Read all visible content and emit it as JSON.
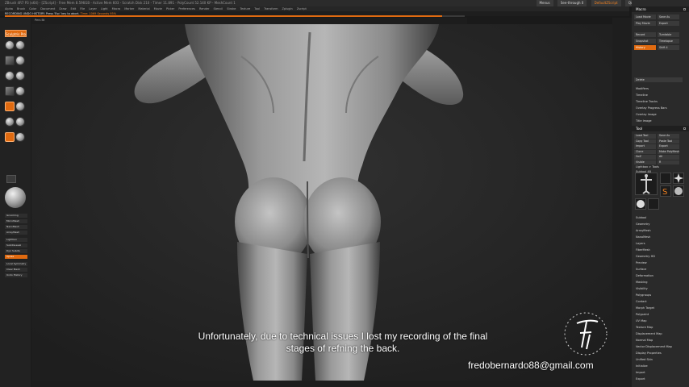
{
  "titlebar": {
    "text": "ZBrush 4R7 P3 (x64) - [ZScript] - Free Mem 8.596GB - Active Mem 603 - Scratch Disk 210 - Timer 11.891 - PolyCount 52.140 KP - MeshCount 1",
    "menus_label": "Menus",
    "layout_label": "DefaultZScript",
    "quicksave_label": "QuickSave",
    "seethrough_label": "See-through 0"
  },
  "menubar": {
    "items": [
      "Alpha",
      "Brush",
      "Color",
      "Document",
      "Draw",
      "Edit",
      "File",
      "Layer",
      "Light",
      "Macro",
      "Marker",
      "Material",
      "Movie",
      "Picker",
      "Preferences",
      "Render",
      "Stencil",
      "Stroke",
      "Texture",
      "Tool",
      "Transform",
      "Zplugin",
      "Zscript"
    ]
  },
  "notice": {
    "prefix": "RECORDING UNDO HISTORY. Press 'Esc' key to abort. ",
    "highlight": "Time: 1069 Seconds 95%"
  },
  "progress": {
    "value": 0.95
  },
  "viewport": {
    "corner_tag": "Pers Bt"
  },
  "leftshelf": {
    "top_button": "Sculptris Pro",
    "buttons": [
      "Grooming",
      "MicroMesh",
      "NanoMesh",
      "ArrayMesh",
      "Lightbox",
      "SubdivLevel",
      "Dyn Subdiv",
      "Xpose",
      "Local Symmetry",
      "Clear Mesh",
      "Undo History"
    ]
  },
  "subtitle": {
    "line1": "Unfortunately, due to technical issues I lost my recording of the final",
    "line2": "stages of refning the back."
  },
  "email": "fredobernardo88@gmail.com",
  "palette": {
    "macro_title": "Macro",
    "macro_buttons": [
      "Load Movie",
      "Save As",
      "Play Movie",
      "Export"
    ],
    "history_buttons": [
      "Record",
      "Turntable",
      "Snapshot",
      "Timelapse",
      "History",
      "Shift 4"
    ],
    "delete_label": "Delete",
    "movie_items": [
      "Modifiers",
      "Timeline",
      "Timeline Tracks",
      "Overlay Progress Bars",
      "Overlay Image",
      "Title Image"
    ],
    "tool_title": "Tool",
    "tool_buttons": [
      "Load Tool",
      "Save As",
      "Copy Tool",
      "Paste Tool",
      "Import",
      "Export",
      "Clone",
      "Make PolyMesh3D",
      "GoZ",
      "All",
      "Visible",
      "R"
    ],
    "lightbox_label": "Lightbox > Tools",
    "subtool_label": "Subtool 48",
    "tool_list": [
      "Subtool",
      "Geometry",
      "ArrayMesh",
      "NanoMesh",
      "Layers",
      "FiberMesh",
      "Geometry HD",
      "Preview",
      "Surface",
      "Deformation",
      "Masking",
      "Visibility",
      "Polygroups",
      "Contact",
      "Morph Target",
      "Polypaint",
      "UV Map",
      "Texture Map",
      "Displacement Map",
      "Normal Map",
      "Vector Displacement Map",
      "Display Properties",
      "Unified Skin",
      "Initialize",
      "Import",
      "Export"
    ]
  },
  "colors": {
    "accent": "#e06a10",
    "panel": "#2a2a2a",
    "background": "#1a1a1a"
  }
}
